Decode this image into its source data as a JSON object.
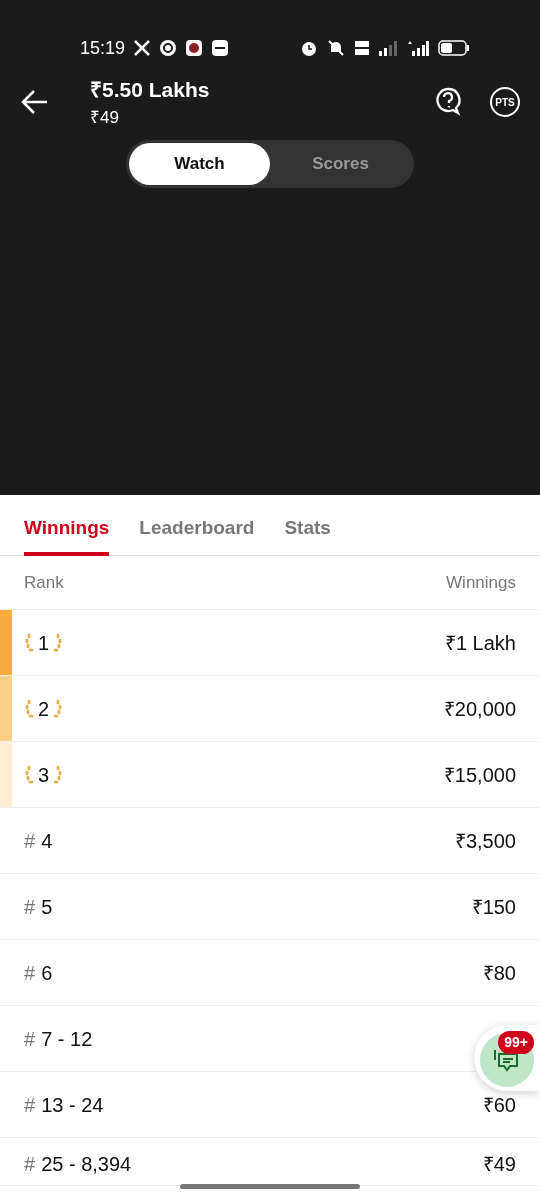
{
  "status_bar": {
    "time": "15:19"
  },
  "header": {
    "title": "₹5.50 Lakhs",
    "subtitle": "₹49",
    "pts_label": "PTS"
  },
  "toggle": [
    {
      "label": "Watch",
      "selected": true
    },
    {
      "label": "Scores",
      "selected": false
    }
  ],
  "tabs": [
    {
      "label": "Winnings",
      "selected": true
    },
    {
      "label": "Leaderboard",
      "selected": false
    },
    {
      "label": "Stats",
      "selected": false
    }
  ],
  "table": {
    "columns": [
      "Rank",
      "Winnings"
    ],
    "rows": [
      {
        "kind": "top",
        "rank": "1",
        "color": "#f5ac3c",
        "winnings": "₹1 Lakh"
      },
      {
        "kind": "top",
        "rank": "2",
        "color": "#fbcf86",
        "winnings": "₹20,000"
      },
      {
        "kind": "top",
        "rank": "3",
        "color": "#fdebd3",
        "winnings": "₹15,000"
      },
      {
        "kind": "range",
        "hash": "#",
        "rank": "4",
        "winnings": "₹3,500"
      },
      {
        "kind": "range",
        "hash": "#",
        "rank": "5",
        "winnings": "₹150"
      },
      {
        "kind": "range",
        "hash": "#",
        "rank": "6",
        "winnings": "₹80"
      },
      {
        "kind": "range",
        "hash": "#",
        "rank": "7 - 12"
      },
      {
        "kind": "range",
        "hash": "#",
        "rank": "13 - 24",
        "winnings": "₹60"
      },
      {
        "kind": "range",
        "hash": "#",
        "rank": "25 - 8,394",
        "winnings": "₹49"
      }
    ]
  },
  "chat_button": {
    "badge": "99+"
  }
}
